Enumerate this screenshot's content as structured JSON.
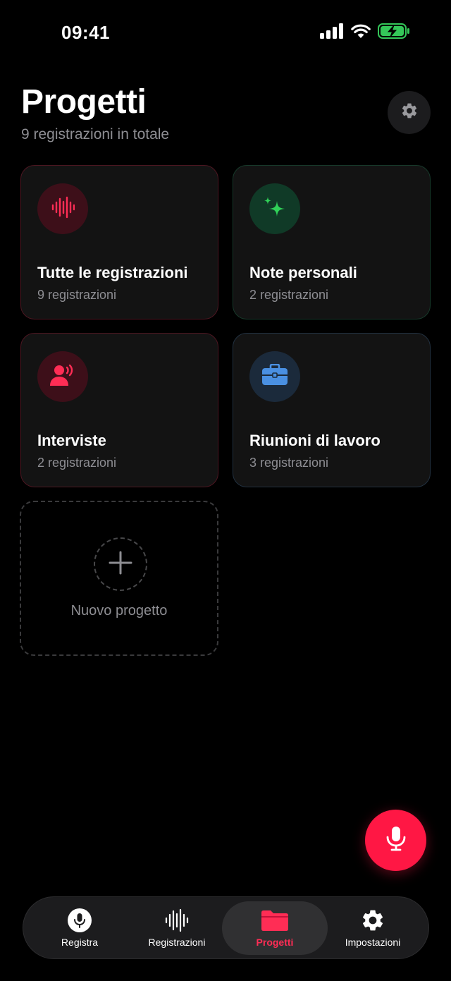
{
  "status_bar": {
    "time": "09:41"
  },
  "header": {
    "title": "Progetti",
    "subtitle": "9 registrazioni in totale"
  },
  "projects": [
    {
      "title": "Tutte le registrazioni",
      "count": "9 registrazioni",
      "icon": "waveform-icon",
      "accent": "#ff2d55"
    },
    {
      "title": "Note personali",
      "count": "2 registrazioni",
      "icon": "sparkles-icon",
      "accent": "#30d158"
    },
    {
      "title": "Interviste",
      "count": "2 registrazioni",
      "icon": "person-speaking-icon",
      "accent": "#ff2d55"
    },
    {
      "title": "Riunioni di lavoro",
      "count": "3 registrazioni",
      "icon": "briefcase-icon",
      "accent": "#4a90e2"
    }
  ],
  "new_project": {
    "label": "Nuovo progetto",
    "icon": "plus-icon"
  },
  "fab": {
    "icon": "microphone-icon",
    "color": "#ff1744"
  },
  "tab_bar": {
    "tabs": [
      {
        "label": "Registra",
        "icon": "microphone-circle-icon"
      },
      {
        "label": "Registrazioni",
        "icon": "waveform-icon"
      },
      {
        "label": "Progetti",
        "icon": "folder-icon",
        "active": true
      },
      {
        "label": "Impostazioni",
        "icon": "gear-icon"
      }
    ]
  }
}
